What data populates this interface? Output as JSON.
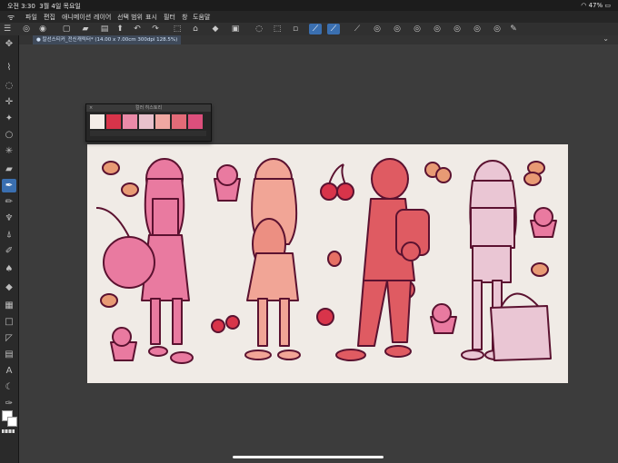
{
  "status": {
    "time": "오전 3:30",
    "date": "3월 4일 목요일",
    "battery": "47%"
  },
  "menu": [
    "파일",
    "편집",
    "애니메이션",
    "레이어",
    "선택 범위",
    "표시",
    "필터",
    "창",
    "도움말"
  ],
  "document_tab": "● 칼선스티커_전신캐릭터* (14.00 x 7.00cm 300dpi 128.5%)",
  "palette": {
    "title": "컬러 히스토리",
    "colors": [
      "#f4ede8",
      "#d8344a",
      "#ea8aa8",
      "#e8c1cc",
      "#f0a8a2",
      "#e26b78",
      "#dc4f7c"
    ]
  },
  "toolbar_icons": [
    "app-menu-icon",
    "new-file-icon",
    "open-file-icon",
    "save-icon",
    "export-icon",
    "undo-icon",
    "redo-icon",
    "lasso-select-icon",
    "deselect-icon",
    "fill-icon",
    "transform-icon",
    "clear-icon",
    "clear-outside-icon",
    "crop-icon",
    "ruler-active-icon",
    "snap-icon",
    "symmetry-icon",
    "snap-ruler-icon",
    "snap-special-icon",
    "snap-grid-icon",
    "snap-perspective-icon",
    "snap-guide-icon",
    "quick-access-icon"
  ],
  "tools": [
    "move-icon",
    "eyedropper-icon",
    "lasso-icon",
    "transform-icon",
    "zoom-icon",
    "rotate-icon",
    "magic-wand-icon",
    "eraser-icon",
    "pen-icon",
    "pencil-icon",
    "brush-icon",
    "airbrush-icon",
    "decoration-icon",
    "blend-icon",
    "fill-icon",
    "gradient-icon",
    "figure-icon",
    "frame-icon",
    "ruler-icon",
    "text-icon",
    "balloon-icon",
    "correction-icon"
  ],
  "art": {
    "figures": [
      {
        "fill": "#e97aa0",
        "stroke": "#5b1230"
      },
      {
        "fill": "#f1a596",
        "stroke": "#5b1230"
      },
      {
        "fill": "#df5b62",
        "stroke": "#5b1230"
      },
      {
        "fill": "#eac6d4",
        "stroke": "#5b1230"
      }
    ]
  }
}
